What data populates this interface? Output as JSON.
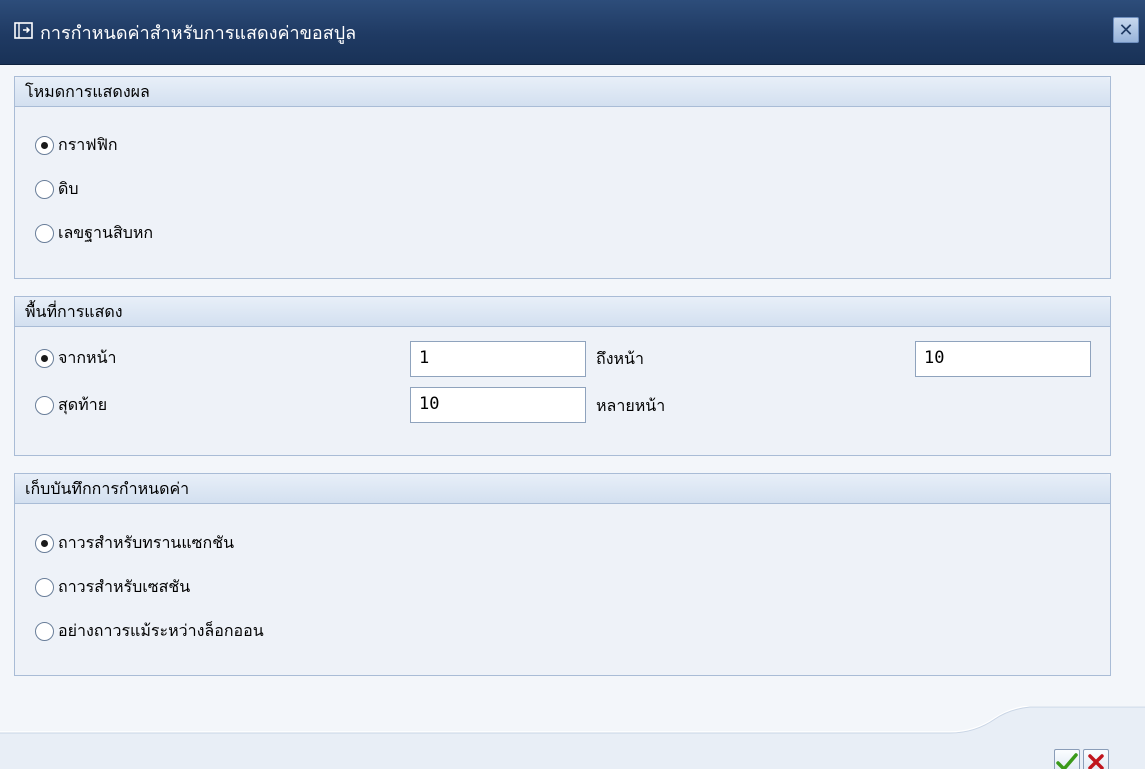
{
  "window": {
    "title": "การกำหนดค่าสำหรับการแสดงค่าขอสปูล",
    "close_symbol": "✕"
  },
  "display_mode": {
    "header": "โหมดการแสดงผล",
    "options": [
      {
        "label": "กราฟฟิก",
        "selected": true
      },
      {
        "label": "ดิบ",
        "selected": false
      },
      {
        "label": "เลขฐานสิบหก",
        "selected": false
      }
    ]
  },
  "display_area": {
    "header": "พื้นที่การแสดง",
    "from_page_label": "จากหน้า",
    "from_page_value": "1",
    "to_page_label": "ถึงหน้า",
    "to_page_value": "10",
    "last_label": "สุดท้าย",
    "last_value": "10",
    "pages_label": "หลายหน้า",
    "from_selected": true
  },
  "save_settings": {
    "header": "เก็บบันทึกการกำหนดค่า",
    "options": [
      {
        "label": "ถาวรสำหรับทรานแซกชัน",
        "selected": true
      },
      {
        "label": "ถาวรสำหรับเซสชัน",
        "selected": false
      },
      {
        "label": "อย่างถาวรแม้ระหว่างล็อกออน",
        "selected": false
      }
    ]
  },
  "footer": {
    "confirm_icon": "check-icon",
    "cancel_icon": "cancel-icon",
    "confirm_color": "#3a9a1a",
    "cancel_color": "#c0151d"
  }
}
